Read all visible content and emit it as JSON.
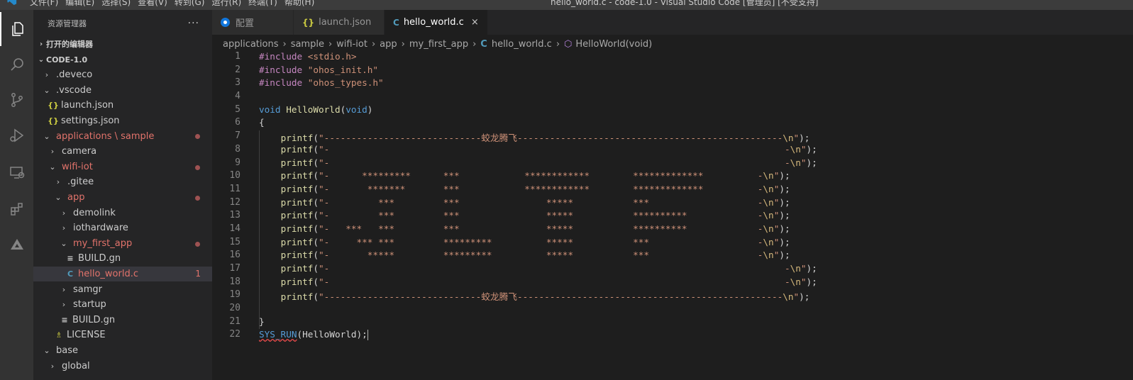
{
  "window": {
    "title": "hello_world.c - code-1.0 - Visual Studio Code [管理员] [不受支持]",
    "menu": [
      "文件(F)",
      "编辑(E)",
      "选择(S)",
      "查看(V)",
      "转到(G)",
      "运行(R)",
      "终端(T)",
      "帮助(H)"
    ]
  },
  "activity_bar": [
    "explorer-icon",
    "search-icon",
    "source-control-icon",
    "run-debug-icon",
    "remote-explorer-icon",
    "extensions-icon",
    "deveco-icon"
  ],
  "sidebar": {
    "title": "资源管理器",
    "more": "···",
    "open_editors": "打开的编辑器",
    "workspace": "CODE-1.0",
    "tree": [
      {
        "label": ".deveco",
        "chev": "›",
        "indent": 1
      },
      {
        "label": ".vscode",
        "chev": "⌄",
        "indent": 1
      },
      {
        "label": "launch.json",
        "icon": "{}",
        "kind": "json",
        "indent": 2
      },
      {
        "label": "settings.json",
        "icon": "{}",
        "kind": "json",
        "indent": 2
      },
      {
        "label": "applications \\ sample",
        "chev": "⌄",
        "indent": 1,
        "modified": true,
        "dot": true
      },
      {
        "label": "camera",
        "chev": "›",
        "indent": 2
      },
      {
        "label": "wifi-iot",
        "chev": "⌄",
        "indent": 2,
        "modified": true,
        "dot": true
      },
      {
        "label": ".gitee",
        "chev": "›",
        "indent": 3
      },
      {
        "label": "app",
        "chev": "⌄",
        "indent": 3,
        "modified": true,
        "dot": true
      },
      {
        "label": "demolink",
        "chev": "›",
        "indent": 4
      },
      {
        "label": "iothardware",
        "chev": "›",
        "indent": 4
      },
      {
        "label": "my_first_app",
        "chev": "⌄",
        "indent": 4,
        "modified": true,
        "dot": true
      },
      {
        "label": "BUILD.gn",
        "icon": "≡",
        "kind": "gn",
        "indent": 5
      },
      {
        "label": "hello_world.c",
        "icon": "C",
        "kind": "c",
        "indent": 5,
        "modified": true,
        "selected": true,
        "badge": "1"
      },
      {
        "label": "samgr",
        "chev": "›",
        "indent": 4
      },
      {
        "label": "startup",
        "chev": "›",
        "indent": 4
      },
      {
        "label": "BUILD.gn",
        "icon": "≡",
        "kind": "gn",
        "indent": 4
      },
      {
        "label": "LICENSE",
        "icon": "♗",
        "kind": "lic",
        "indent": 3
      },
      {
        "label": "base",
        "chev": "⌄",
        "indent": 1
      },
      {
        "label": "global",
        "chev": "›",
        "indent": 2
      }
    ]
  },
  "tabs": [
    {
      "label": "配置",
      "icon": "settings-circle",
      "active": false
    },
    {
      "label": "launch.json",
      "icon": "{}",
      "kind": "json",
      "active": false
    },
    {
      "label": "hello_world.c",
      "icon": "C",
      "kind": "c",
      "active": true,
      "close": "×"
    }
  ],
  "breadcrumb": [
    "applications",
    "sample",
    "wifi-iot",
    "app",
    "my_first_app",
    "hello_world.c",
    "HelloWorld(void)"
  ],
  "editor": {
    "lines": [
      "#include <stdio.h>",
      "#include \"ohos_init.h\"",
      "#include \"ohos_types.h\"",
      "",
      "void HelloWorld(void)",
      "{",
      "    printf(\"-----------------------------蛟龙腾飞-------------------------------------------------\\n\");",
      "    printf(\"-                                                                                    -\\n\");",
      "    printf(\"-                                                                                    -\\n\");",
      "    printf(\"-      *********      ***            ************        *************          -\\n\");",
      "    printf(\"-       *******       ***            ************        *************          -\\n\");",
      "    printf(\"-         ***         ***                *****           ***                    -\\n\");",
      "    printf(\"-         ***         ***                *****           **********             -\\n\");",
      "    printf(\"-   ***   ***         ***                *****           **********             -\\n\");",
      "    printf(\"-     *** ***         *********          *****           ***                    -\\n\");",
      "    printf(\"-       *****         *********          *****           ***                    -\\n\");",
      "    printf(\"-                                                                                    -\\n\");",
      "    printf(\"-                                                                                    -\\n\");",
      "    printf(\"-----------------------------蛟龙腾飞-------------------------------------------------\\n\");",
      "",
      "}",
      "SYS_RUN(HelloWorld);"
    ]
  }
}
